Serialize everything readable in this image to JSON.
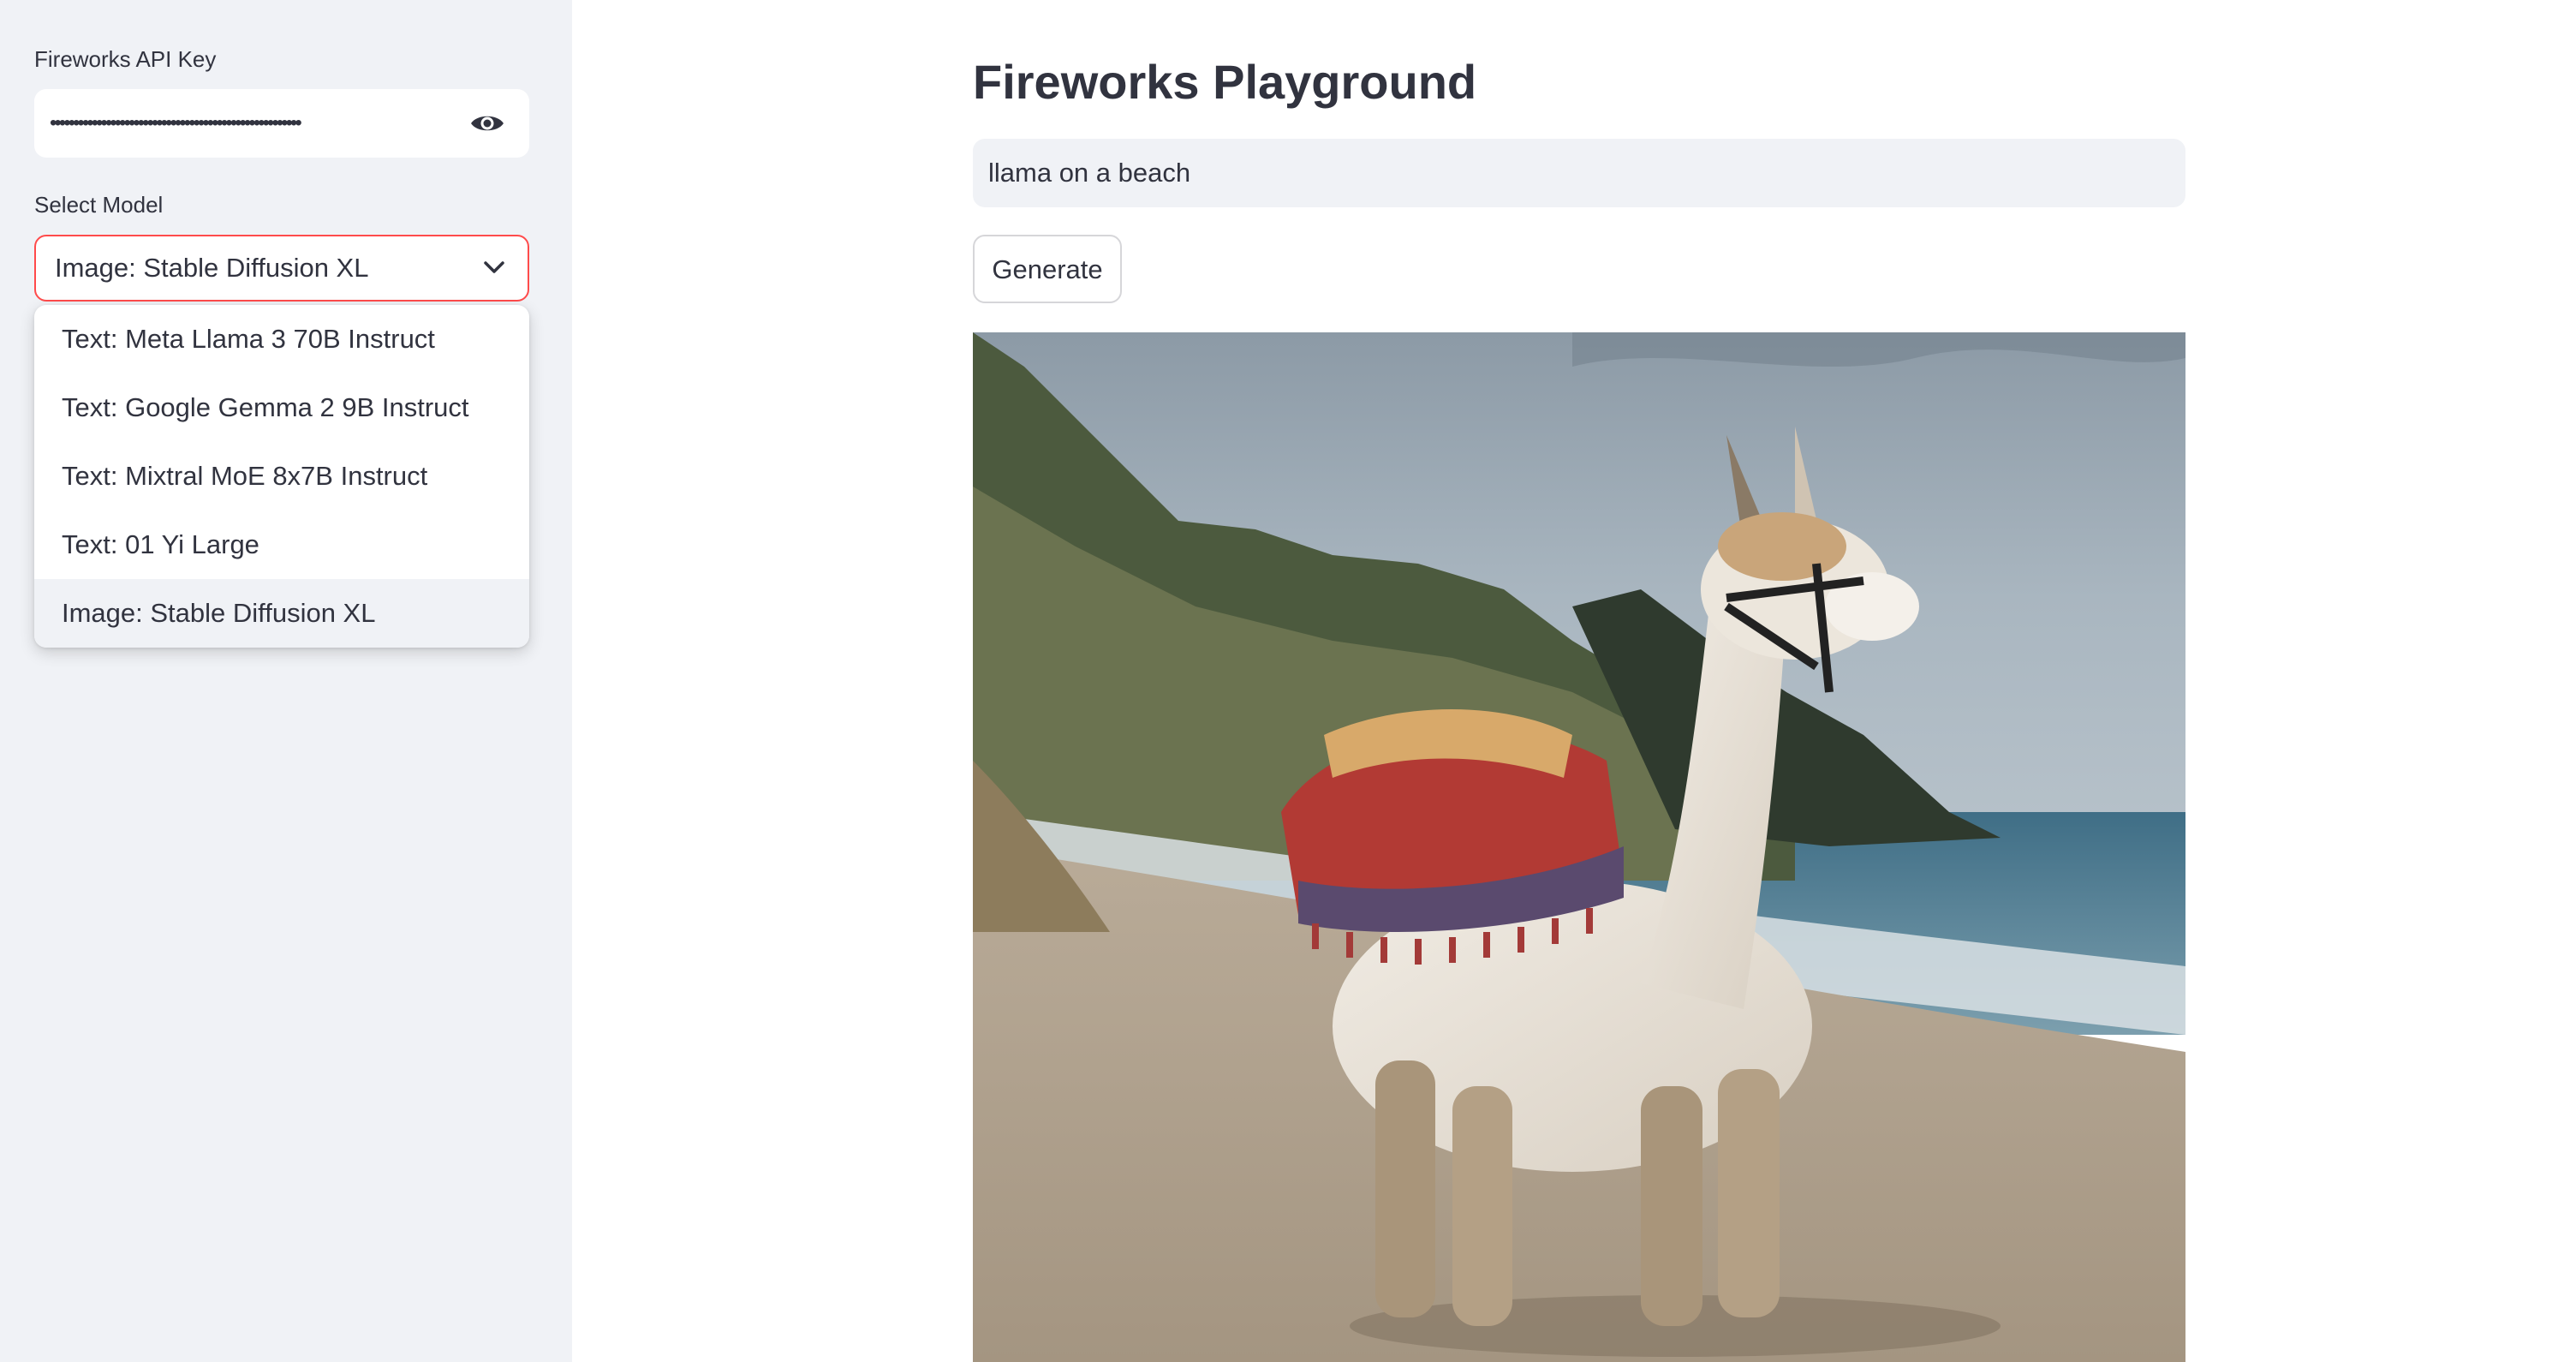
{
  "sidebar": {
    "api_key_label": "Fireworks API Key",
    "api_key_value": "••••••••••••••••••••••••••••••••••••••••••••••••••••••",
    "api_key_icon": "eye-icon",
    "model_label": "Select Model",
    "selected_model": "Image: Stable Diffusion XL",
    "dropdown_icon": "chevron-down-icon",
    "model_options": [
      "Text: Meta Llama 3 70B Instruct",
      "Text: Google Gemma 2 9B Instruct",
      "Text: Mixtral MoE 8x7B Instruct",
      "Text: 01 Yi Large",
      "Image: Stable Diffusion XL"
    ]
  },
  "main": {
    "title": "Fireworks Playground",
    "prompt_value": "llama on a beach",
    "generate_label": "Generate",
    "image_subject": "llama on a beach"
  },
  "colors": {
    "sidebar_bg": "#f0f2f6",
    "accent_focus": "#ff4b4b",
    "text": "#31333f"
  }
}
